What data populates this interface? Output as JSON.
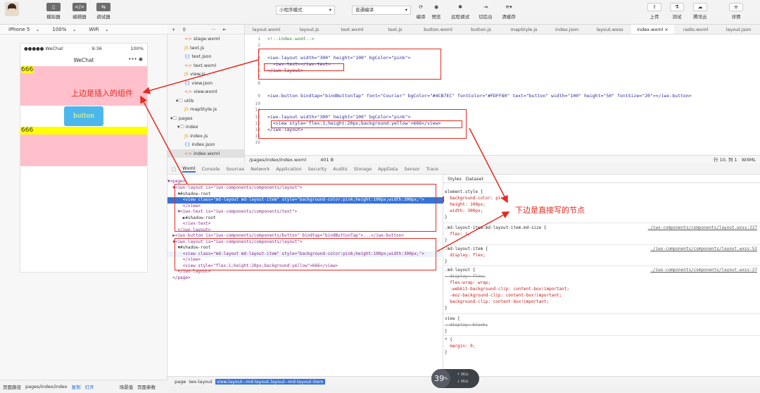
{
  "toolbar": {
    "simulator": "模拟器",
    "editor": "编辑器",
    "debugger": "调试器",
    "mode": "小程序模式",
    "compile_mode": "普通编译",
    "compile": "编译",
    "preview": "预览",
    "remote_debug": "远程调试",
    "switch_bg": "切后台",
    "clear_cache": "清缓存",
    "upload": "上传",
    "test": "测试",
    "tencent_cloud": "腾讯云",
    "details": "详情"
  },
  "device_bar": {
    "device": "iPhone 5",
    "zoom": "100%",
    "network": "WiFi"
  },
  "phone": {
    "carrier": "●●●●● WeChat",
    "time": "9:36",
    "battery": "100%",
    "nav_title": "WeChat",
    "nav_dots": "•••",
    "text_666_a": "666",
    "button_label": "button",
    "text_666_b": "666"
  },
  "sim_footer": {
    "path_label": "页面路径",
    "path": "pages/index/index",
    "copy": "复制",
    "open": "打开",
    "scene": "场景值",
    "params": "页面参数"
  },
  "tree": {
    "items": [
      {
        "label": "stage.wxml",
        "kind": "wxml"
      },
      {
        "label": "text.js",
        "kind": "js"
      },
      {
        "label": "text.json",
        "kind": "json"
      },
      {
        "label": "text.wxml",
        "kind": "wxml"
      },
      {
        "label": "view.js",
        "kind": "js"
      },
      {
        "label": "view.json",
        "kind": "json"
      },
      {
        "label": "view.wxml",
        "kind": "wxml"
      },
      {
        "label": "utils",
        "kind": "folder"
      },
      {
        "label": "mapStyle.js",
        "kind": "js"
      },
      {
        "label": "pages",
        "kind": "folder"
      },
      {
        "label": "index",
        "kind": "folder"
      },
      {
        "label": "index.js",
        "kind": "js"
      },
      {
        "label": "index.json",
        "kind": "json"
      },
      {
        "label": "index.wxml",
        "kind": "wxml"
      }
    ]
  },
  "tabs": [
    "layout.wxml",
    "layout.js",
    "text.wxml",
    "text.js",
    "button.wxml",
    "button.js",
    "mapStyle.js",
    "index.json",
    "layout.wxss",
    "index.wxml ×",
    "radio.wxml",
    "layout.json"
  ],
  "code": {
    "l1_num": "1",
    "l1": "<!--index.wxml-->",
    "l2_num": "2",
    "l3_num": "3",
    "l4_num": "4",
    "l5_num": "5",
    "l6_num": "6",
    "l7_num": "7",
    "l8_num": "8",
    "l9_num": "9",
    "l10_num": "10",
    "l11_num": "11",
    "l12_num": "12",
    "l13_num": "13",
    "l14_num": "14",
    "l15_num": "15",
    "l16_num": "16",
    "a1": "<iwx-layout width=\"300\" height=\"100\" bgColor=\"pink\">",
    "a2": "<iwx-text></iwx-text>",
    "a3": "</iwx-layout>",
    "b1": "<iwx-button bindtap=\"bindButtonTap\" font=\"Courier\" bgColor=\"#4CB7EC\" fontColor=\"#FDFF80\" text=\"button\" width=\"100\" height=\"50\" fontSize=\"20\"></iwx-button>",
    "c1": "<iwx-layout width=\"300\" height=\"100\" bgColor=\"pink\">",
    "c2": "<view style='flex:1;height:20px;background:yellow'>666</view>",
    "c3": "</iwx-layout>"
  },
  "code_status": {
    "path": "/pages/index/index.wxml",
    "size": "401 B",
    "pos": "行 10, 列 1",
    "lang": "WXML"
  },
  "devtools_tabs": [
    "Wxml",
    "Console",
    "Sources",
    "Network",
    "Application",
    "Security",
    "Audits",
    "Storage",
    "AppData",
    "Sensor",
    "Trace"
  ],
  "dom": {
    "d0": "▼<page>",
    "d1": "  ▼<iwx-layout is=\"iwx-components/components/layout\">",
    "d2": "    ▼#shadow-root",
    "d3": "      <view class=\"md-layout md-layout-item\" style=\"background-color:pink;height:100px;width:300px;\">",
    "d4": "      </view>",
    "d5": "    ▼<iwx-text is=\"iwx-components/components/text\">",
    "d6": "      ▶#shadow-root",
    "d7": "      </iwx-text>",
    "d8": "    </iwx-layout>",
    "d9": "  ▶<iwx-button is=\"iwx-components/components/button\" bindtap=\"bindButtonTap\">...</iwx-button>",
    "d10": "  ▼<iwx-layout is=\"iwx-components/components/layout\">",
    "d11": "    ▼#shadow-root",
    "d12": "      <view class=\"md-layout md-layout-item\" style=\"background-color:pink;height:100px;width:300px;\">",
    "d13": "      </view>",
    "d14": "      <view style=\"flex:1;height:20px;background:yellow\">666</view>",
    "d15": "    </iwx-layout>",
    "d16": "  </page>"
  },
  "styles": {
    "tab_styles": "Styles",
    "tab_dataset": "Dataset",
    "s1": "element.style {",
    "s2": "  background-color: pink;",
    "s3": "  height: 100px;",
    "s4": "  width: 300px;",
    "s5": "}",
    "s6": ".md-layout-item.md-layout-item.md-size {",
    "s6src": "./iwx-components/components/layout.wxss:227",
    "s7": "  flex: 1;",
    "s8": "}",
    "s9": ".md-layout-item {",
    "s9src": "./iwx-components/components/layout.wxss:52",
    "s10": "  display: flex;",
    "s11": "}",
    "s12": ".md-layout {",
    "s12src": "./iwx-components/components/layout.wxss:27",
    "s13": "  display: flex;",
    "s14": "  flex-wrap: wrap;",
    "s15": "  -webkit-background-clip: content-box!important;",
    "s16": "  -moz-background-clip: content-box!important;",
    "s17": "  background-clip: content-box!important;",
    "s18": "}",
    "s19": "view {",
    "s20": "  display: block;",
    "s21": "}",
    "s22": "* {",
    "s23": "  margin: 0;",
    "s24": "}"
  },
  "breadcrumb": {
    "b1": "page",
    "b2": "iwx-layout",
    "b3": "view.layout--md-layout.layout--md-layout-item"
  },
  "gauge": {
    "value": "39",
    "unit": "%",
    "up": "0K/s",
    "down": "0K/s"
  },
  "annotations": {
    "top": "上边是插入的组件",
    "bottom": "下边是直接写的节点"
  },
  "colors": {
    "accent": "#e52a1e",
    "selection": "#3874d8",
    "button_bg": "#4CB7EC",
    "button_fg": "#FDFF80"
  }
}
